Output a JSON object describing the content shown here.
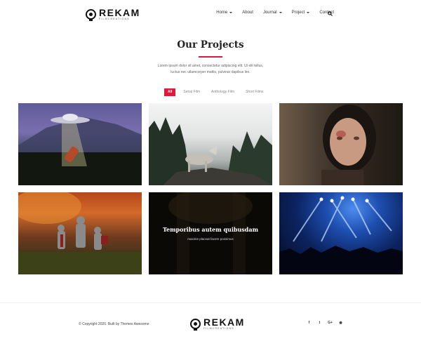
{
  "header": {
    "logo_word": "REKAM",
    "logo_sub": "FILMCREATIONS",
    "nav": [
      {
        "label": "Home",
        "dropdown": true
      },
      {
        "label": "About",
        "dropdown": false
      },
      {
        "label": "Journal",
        "dropdown": true
      },
      {
        "label": "Project",
        "dropdown": true
      },
      {
        "label": "Contact",
        "dropdown": false
      }
    ],
    "search_icon": "search-icon"
  },
  "section": {
    "title": "Our Projects",
    "intro": "Lorem ipsum dolor sit amet, consectetur adipiscing elit. Ut elit tellus, luctus nec ullamcorper mattis, pulvinar dapibus leo.",
    "filters": [
      "All",
      "Serial Film",
      "Anthology Film",
      "Short Films"
    ],
    "active_filter": "All"
  },
  "projects": [
    {
      "image": "ufo-abduction"
    },
    {
      "image": "wolf-on-rock"
    },
    {
      "image": "injured-woman"
    },
    {
      "image": "knights-battle"
    },
    {
      "image": "dark-overlay",
      "title": "Temporibus autem quibusdam",
      "subtitle": "maxime placeat facere possimus"
    },
    {
      "image": "concert-lights"
    }
  ],
  "footer": {
    "copyright": "© Copyright 2020. Built by Themes Awesome",
    "logo_word": "REKAM",
    "logo_sub": "FILMCREATIONS",
    "social": [
      {
        "icon": "facebook-icon",
        "glyph": "f"
      },
      {
        "icon": "twitter-icon",
        "glyph": "t"
      },
      {
        "icon": "google-plus-icon",
        "glyph": "G+"
      },
      {
        "icon": "dribbble-icon",
        "glyph": "◉"
      }
    ]
  },
  "colors": {
    "accent": "#e2173b"
  }
}
